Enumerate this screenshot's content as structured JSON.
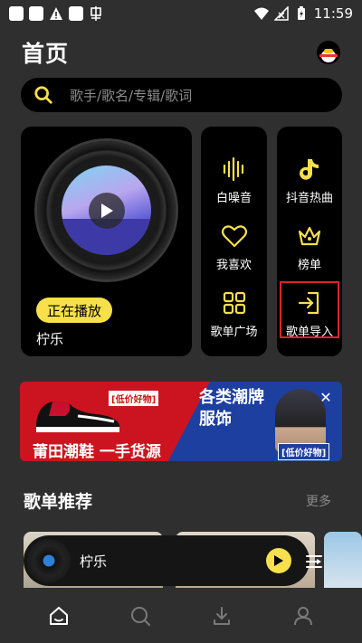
{
  "status_bar": {
    "time": "11:59",
    "icons": [
      "notification-icon",
      "notification-icon",
      "warning-icon",
      "notification-icon",
      "app-icon",
      "wifi-icon",
      "signal-icon",
      "battery-icon"
    ]
  },
  "header": {
    "title": "首页",
    "avatar_icon": "penguin-avatar-icon"
  },
  "search": {
    "placeholder": "歌手/歌名/专辑/歌词",
    "icon": "search-icon"
  },
  "now_playing_card": {
    "badge": "正在播放",
    "song_title": "柠乐",
    "play_icon": "play-icon"
  },
  "features_middle": [
    {
      "label": "白噪音",
      "icon": "waveform-icon"
    },
    {
      "label": "我喜欢",
      "icon": "heart-icon"
    },
    {
      "label": "歌单广场",
      "icon": "grid-icon"
    }
  ],
  "features_right": [
    {
      "label": "抖音热曲",
      "icon": "tiktok-icon"
    },
    {
      "label": "榜单",
      "icon": "crown-icon"
    },
    {
      "label": "歌单导入",
      "icon": "import-icon"
    }
  ],
  "banner": {
    "tag_left": "[低价好物]",
    "main_text": "莆田潮鞋 一手货源",
    "right_title": "各类潮牌服饰",
    "tag_right": "[低价好物]",
    "close_label": "✕"
  },
  "section": {
    "title": "歌单推荐",
    "more": "更多"
  },
  "mini_player": {
    "title": "柠乐"
  },
  "bottom_nav": [
    {
      "icon": "home-icon",
      "active": true
    },
    {
      "icon": "search-icon",
      "active": false
    },
    {
      "icon": "download-icon",
      "active": false
    },
    {
      "icon": "user-icon",
      "active": false
    }
  ],
  "colors": {
    "accent": "#f7e04b",
    "background": "#2f2f2f",
    "card": "#000000",
    "highlight": "#e0212a"
  }
}
